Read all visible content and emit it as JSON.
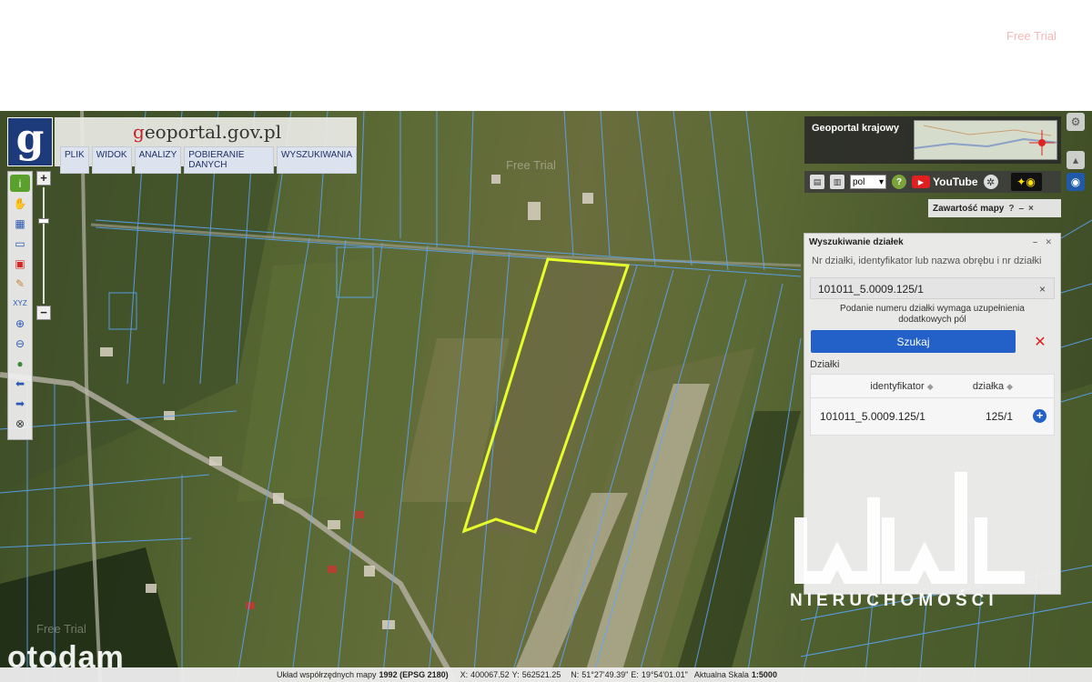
{
  "watermarks": {
    "free_trial": "Free Trial",
    "wwl_subtitle": "NIERUCHOMOŚCI",
    "otodam": "otodam"
  },
  "header": {
    "logo_letter": "g",
    "site_title_prefix": "g",
    "site_title_rest": "eoportal.gov.pl",
    "menu": [
      "PLIK",
      "WIDOK",
      "ANALIZY",
      "POBIERANIE DANYCH",
      "WYSZUKIWANIA"
    ]
  },
  "mini_map": {
    "label": "Geoportal krajowy"
  },
  "toolstrip": {
    "language": "pol",
    "help": "?",
    "youtube": "YouTube"
  },
  "map_content": {
    "label": "Zawartość mapy",
    "help": "?",
    "minimize": "–",
    "close": "×"
  },
  "search_panel": {
    "title": "Wyszukiwanie działek",
    "prompt": "Nr działki, identyfikator lub nazwa obrębu i nr działki",
    "input_value": "101011_5.0009.125/1",
    "clear": "×",
    "hint": "Podanie numeru działki wymaga uzupełnienia dodatkowych pól",
    "search_button": "Szukaj",
    "cancel": "✕",
    "results_label": "Działki",
    "columns": [
      "identyfikator",
      "działka"
    ],
    "rows": [
      {
        "identyfikator": "101011_5.0009.125/1",
        "dzialka": "125/1"
      }
    ]
  },
  "statusbar": {
    "crs_label": "Układ współrzędnych mapy",
    "crs_value": "1992 (EPSG 2180)",
    "x_label": "X:",
    "x_value": "400067.52",
    "y_label": "Y:",
    "y_value": "562521.25",
    "n_label": "N:",
    "n_value": "51°27'49.39\"",
    "e_label": "E:",
    "e_value": "19°54'01.01\"",
    "scale_label": "Aktualna Skala",
    "scale_value": "1:5000"
  },
  "colors": {
    "parcel_outline": "#e6ff2a",
    "parcel_lines": "#5aa8ff",
    "button_blue": "#2361c8",
    "logo_blue": "#1d3a7a"
  }
}
